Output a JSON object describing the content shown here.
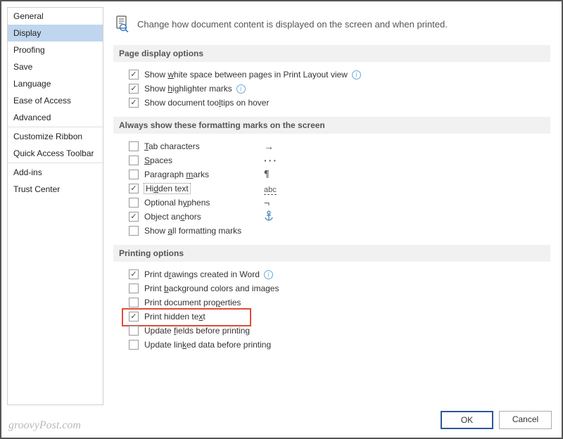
{
  "sidebar": {
    "items": [
      {
        "label": "General"
      },
      {
        "label": "Display",
        "selected": true
      },
      {
        "label": "Proofing"
      },
      {
        "label": "Save"
      },
      {
        "label": "Language"
      },
      {
        "label": "Ease of Access"
      },
      {
        "label": "Advanced"
      },
      {
        "label": "Customize Ribbon"
      },
      {
        "label": "Quick Access Toolbar"
      },
      {
        "label": "Add-ins"
      },
      {
        "label": "Trust Center"
      }
    ]
  },
  "header": {
    "title": "Change how document content is displayed on the screen and when printed."
  },
  "sections": {
    "page_display": {
      "title": "Page display options",
      "opts": [
        {
          "label_pre": "Show ",
          "u": "w",
          "label_post": "hite space between pages in Print Layout view",
          "checked": true,
          "info": true
        },
        {
          "label_pre": "Show ",
          "u": "h",
          "label_post": "ighlighter marks",
          "checked": true,
          "info": true
        },
        {
          "label_pre": "Show document too",
          "u": "l",
          "label_post": "tips on hover",
          "checked": true,
          "info": false
        }
      ]
    },
    "formatting_marks": {
      "title": "Always show these formatting marks on the screen",
      "opts": [
        {
          "pre": "",
          "u": "T",
          "post": "ab characters",
          "checked": false,
          "symbol": "arrow"
        },
        {
          "pre": "",
          "u": "S",
          "post": "paces",
          "checked": false,
          "symbol": "dots"
        },
        {
          "pre": "Paragraph ",
          "u": "m",
          "post": "arks",
          "checked": false,
          "symbol": "pilcrow"
        },
        {
          "pre": "Hi",
          "u": "d",
          "post": "den text",
          "checked": true,
          "symbol": "abc",
          "boxed": true
        },
        {
          "pre": "Optional h",
          "u": "y",
          "post": "phens",
          "checked": false,
          "symbol": "not"
        },
        {
          "pre": "Object an",
          "u": "c",
          "post": "hors",
          "checked": true,
          "symbol": "anchor"
        },
        {
          "pre": "Show ",
          "u": "a",
          "post": "ll formatting marks",
          "checked": false,
          "symbol": ""
        }
      ]
    },
    "printing": {
      "title": "Printing options",
      "opts": [
        {
          "pre": "Print d",
          "u": "r",
          "post": "awings created in Word",
          "checked": true,
          "info": true
        },
        {
          "pre": "Print ",
          "u": "b",
          "post": "ackground colors and images",
          "checked": false
        },
        {
          "pre": "Print document pro",
          "u": "p",
          "post": "erties",
          "checked": false
        },
        {
          "pre": "Print hidden te",
          "u": "x",
          "post": "t",
          "checked": true,
          "highlighted": true
        },
        {
          "pre": "Update ",
          "u": "f",
          "post": "ields before printing",
          "checked": false
        },
        {
          "pre": "Update lin",
          "u": "k",
          "post": "ed data before printing",
          "checked": false
        }
      ]
    }
  },
  "footer": {
    "ok": "OK",
    "cancel": "Cancel"
  },
  "watermark": {
    "a": "groovy",
    "b": "Post",
    "c": ".com"
  }
}
